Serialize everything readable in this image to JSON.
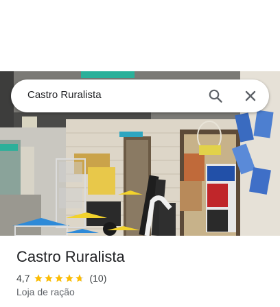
{
  "search": {
    "query": "Castro Ruralista"
  },
  "icons": {
    "search": "search-icon",
    "close": "close-icon",
    "star": "star-icon"
  },
  "place": {
    "title": "Castro Ruralista",
    "rating": "4,7",
    "rating_value": 4.7,
    "review_count": "(10)",
    "category": "Loja de ração"
  },
  "colors": {
    "star": "#fbbc04",
    "icon": "#5f6368",
    "text_primary": "#202124",
    "text_secondary": "#5f6368"
  }
}
